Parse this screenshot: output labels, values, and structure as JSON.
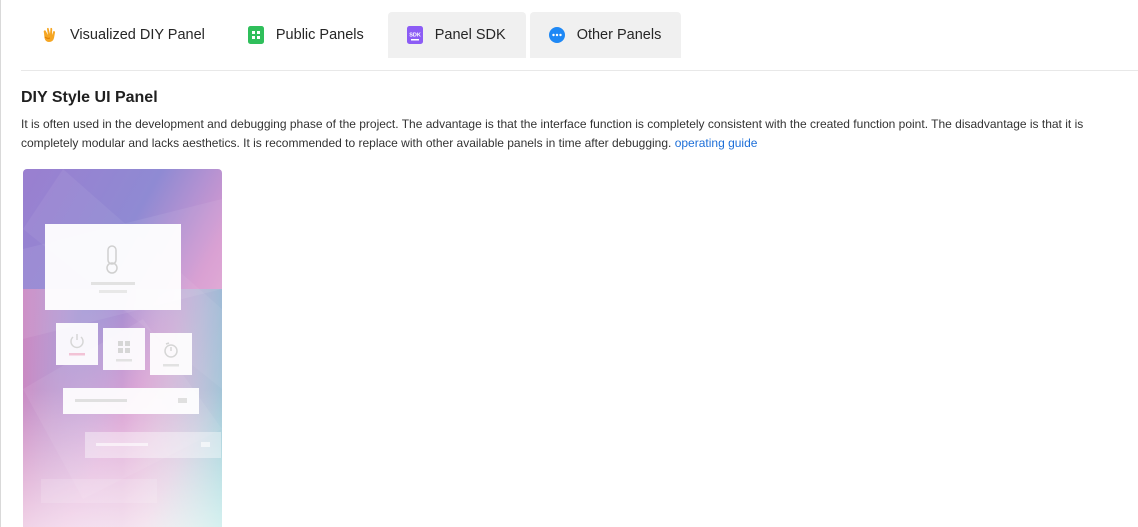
{
  "tabs": [
    {
      "label": "Visualized DIY Panel",
      "icon": "hand-wave-icon",
      "color": "#f5a623"
    },
    {
      "label": "Public Panels",
      "icon": "grid-icon",
      "color": "#2fbf5b"
    },
    {
      "label": "Panel SDK",
      "icon": "sdk-icon",
      "color": "#8c5cf5",
      "icon_text": "SDK"
    },
    {
      "label": "Other Panels",
      "icon": "more-dots-icon",
      "color": "#1e88f5"
    }
  ],
  "section": {
    "title": "DIY Style UI Panel",
    "description": "It is often used in the development and debugging phase of the project. The advantage is that the interface function is completely consistent with the created function point. The disadvantage is that it is completely modular and lacks aesthetics. It is recommended to replace with other available panels in time after debugging.",
    "guide_link": "operating guide"
  },
  "preview": {
    "icons": [
      "thermometer-icon",
      "power-icon",
      "grid-icon",
      "timer-icon"
    ]
  }
}
